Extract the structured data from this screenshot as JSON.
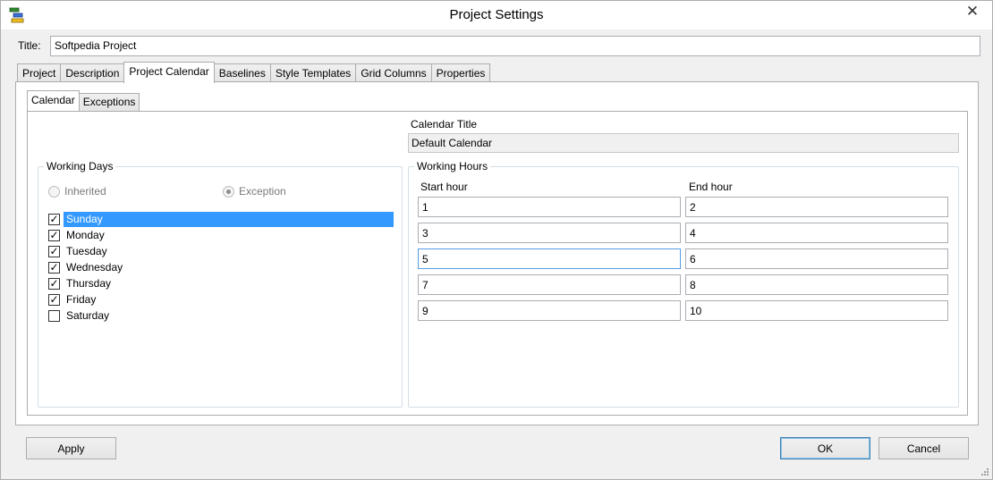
{
  "window": {
    "title": "Project Settings",
    "close_glyph": "✕"
  },
  "title_field": {
    "label": "Title:",
    "value": "Softpedia Project"
  },
  "tabs": [
    {
      "label": "Project"
    },
    {
      "label": "Description"
    },
    {
      "label": "Project Calendar",
      "active": true
    },
    {
      "label": "Baselines"
    },
    {
      "label": "Style Templates"
    },
    {
      "label": "Grid Columns"
    },
    {
      "label": "Properties"
    }
  ],
  "inner_tabs": [
    {
      "label": "Calendar",
      "active": true
    },
    {
      "label": "Exceptions"
    }
  ],
  "calendar": {
    "title_label": "Calendar Title",
    "title_value": "Default Calendar"
  },
  "working_days": {
    "legend": "Working Days",
    "radio_inherited": "Inherited",
    "radio_exception": "Exception",
    "selected_radio": "Exception",
    "days": [
      {
        "label": "Sunday",
        "checked": true,
        "selected": true
      },
      {
        "label": "Monday",
        "checked": true
      },
      {
        "label": "Tuesday",
        "checked": true
      },
      {
        "label": "Wednesday",
        "checked": true
      },
      {
        "label": "Thursday",
        "checked": true
      },
      {
        "label": "Friday",
        "checked": true
      },
      {
        "label": "Saturday",
        "checked": false
      }
    ]
  },
  "working_hours": {
    "legend": "Working Hours",
    "start_header": "Start hour",
    "end_header": "End hour",
    "rows": [
      {
        "start": "1",
        "end": "2"
      },
      {
        "start": "3",
        "end": "4"
      },
      {
        "start": "5",
        "end": "6"
      },
      {
        "start": "7",
        "end": "8"
      },
      {
        "start": "9",
        "end": "10"
      }
    ]
  },
  "buttons": {
    "apply": "Apply",
    "ok": "OK",
    "cancel": "Cancel"
  },
  "colors": {
    "selection": "#3399ff",
    "focus_border": "#569de5"
  }
}
